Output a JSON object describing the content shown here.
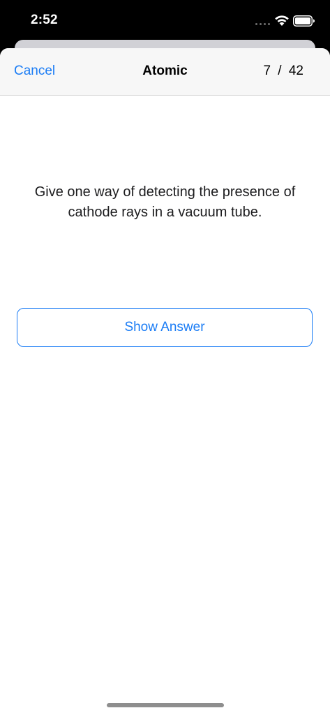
{
  "status_bar": {
    "time": "2:52",
    "icons": [
      "signal-dots-icon",
      "wifi-icon",
      "battery-icon"
    ]
  },
  "nav": {
    "cancel_label": "Cancel",
    "title": "Atomic",
    "progress": "7 / 42"
  },
  "card": {
    "question": "Give one way of detecting the presence of cathode rays in a vacuum tube.",
    "show_answer_label": "Show Answer"
  },
  "colors": {
    "accent": "#1a7cf5",
    "nav_background": "#f7f7f7",
    "status_bar_background": "#000000"
  }
}
